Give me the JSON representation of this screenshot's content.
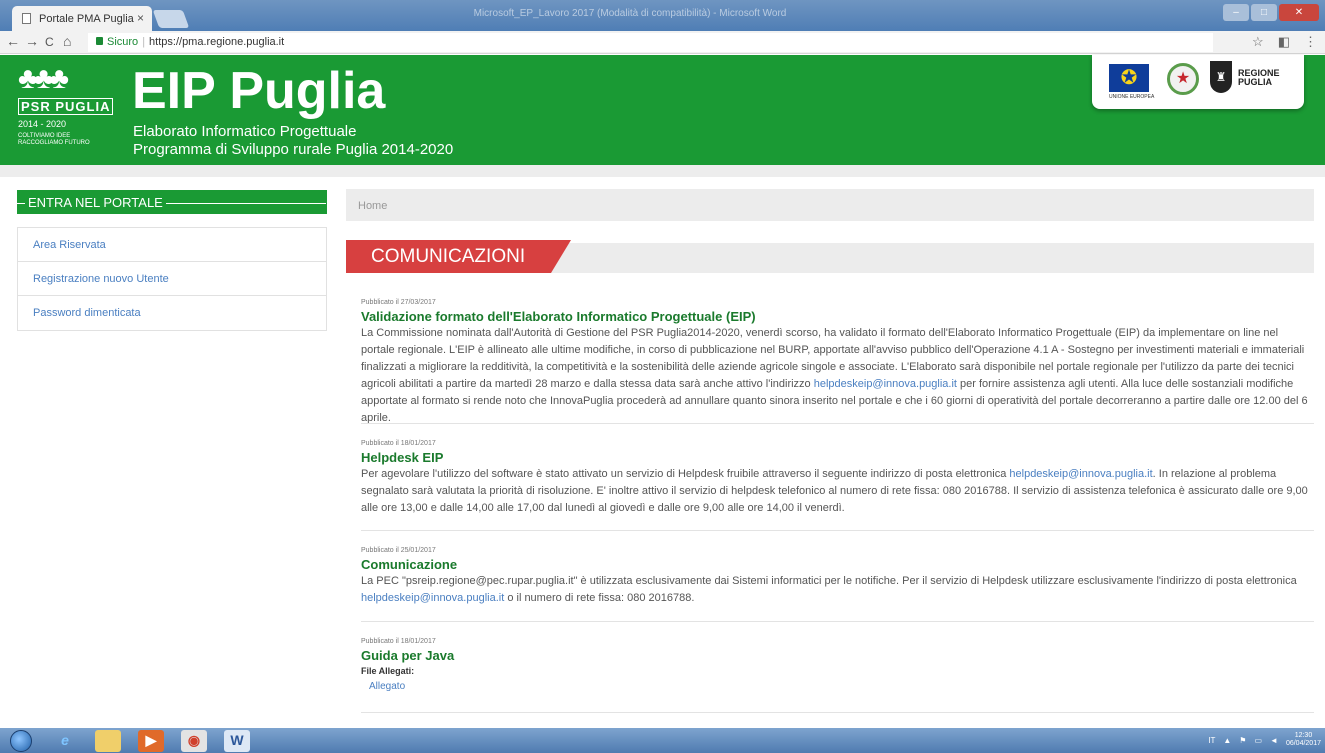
{
  "browser": {
    "tab_title": "Portale PMA Puglia",
    "tab_close": "×",
    "window_title": "Microsoft_EP_Lavoro 2017 (Modalità di compatibilità) - Microsoft Word",
    "secure_label": "Sicuro",
    "url": "https://pma.regione.puglia.it",
    "back_icon": "←",
    "forward_icon": "→",
    "reload_icon": "C",
    "home_icon": "⌂"
  },
  "header": {
    "logo_name": "PSR PUGLIA",
    "logo_years": "2014 - 2020",
    "logo_motto_1": "COLTIVIAMO IDEE",
    "logo_motto_2": "RACCOGLIAMO FUTURO",
    "title": "EIP Puglia",
    "subtitle_1": "Elaborato Informatico Progettuale",
    "subtitle_2": "Programma di Sviluppo rurale Puglia 2014-2020",
    "eu_label": "UNIONE EUROPEA",
    "region_line1": "REGIONE",
    "region_line2": "PUGLIA"
  },
  "sidebar": {
    "heading": "ENTRA NEL PORTALE",
    "items": [
      {
        "label": "Area Riservata"
      },
      {
        "label": "Registrazione nuovo Utente"
      },
      {
        "label": "Password dimenticata"
      }
    ]
  },
  "main": {
    "breadcrumb": "Home",
    "section_title": "COMUNICAZIONI",
    "news": [
      {
        "date": "Pubblicato il 27/03/2017",
        "title": "Validazione formato dell'Elaborato Informatico Progettuale (EIP)",
        "text_before": "La Commissione nominata dall'Autorità di Gestione del PSR Puglia2014-2020, venerdì scorso, ha validato il formato dell'Elaborato Informatico Progettuale (EIP) da implementare on line nel portale regionale. L'EIP è allineato alle ultime modifiche, in corso di pubblicazione nel BURP, apportate all'avviso pubblico dell'Operazione 4.1 A - Sostegno per investimenti materiali e immateriali finalizzati a migliorare la redditività, la competitività e la sostenibilità delle aziende agricole singole e associate. L'Elaborato sarà disponibile nel portale regionale per l'utilizzo da parte dei tecnici agricoli abilitati a partire da martedì 28 marzo e dalla stessa data sarà anche attivo l'indirizzo ",
        "link": "helpdeskeip@innova.puglia.it",
        "text_after": " per fornire assistenza agli utenti. Alla luce delle sostanziali modifiche apportate al formato si rende noto che InnovaPuglia procederà ad annullare quanto sinora inserito nel portale e che i 60 giorni di operatività del portale decorreranno a partire dalle ore 12.00 del 6 aprile."
      },
      {
        "date": "Pubblicato il 18/01/2017",
        "title": "Helpdesk EIP",
        "text_before": "Per agevolare l'utilizzo del software è stato attivato un servizio di Helpdesk fruibile attraverso il seguente indirizzo di posta elettronica ",
        "link": "helpdeskeip@innova.puglia.it",
        "text_after": ". In relazione al problema segnalato sarà valutata la priorità di risoluzione. E' inoltre attivo il servizio di helpdesk telefonico al numero di rete fissa: 080 2016788. Il servizio di assistenza telefonica è assicurato dalle ore 9,00 alle ore 13,00 e dalle 14,00 alle 17,00 dal lunedì al giovedì e dalle ore 9,00 alle ore 14,00 il venerdì."
      },
      {
        "date": "Pubblicato il 25/01/2017",
        "title": "Comunicazione",
        "text_before": "La PEC \"psreip.regione@pec.rupar.puglia.it\" è utilizzata esclusivamente dai Sistemi informatici per le notifiche. Per il servizio di Helpdesk utilizzare esclusivamente l'indirizzo di posta elettronica ",
        "link": "helpdeskeip@innova.puglia.it",
        "text_after": " o il numero di rete fissa: 080 2016788."
      },
      {
        "date": "Pubblicato il 18/01/2017",
        "title": "Guida per Java",
        "attachments_label": "File Allegati:",
        "attachment_link": "Allegato"
      }
    ]
  },
  "taskbar": {
    "language": "IT",
    "time": "12:30",
    "date": "06/04/2017"
  },
  "colors": {
    "brand_green": "#1a9a34",
    "title_green": "#1a7a2c",
    "section_red": "#d74040",
    "link_blue": "#4a7fc1"
  }
}
